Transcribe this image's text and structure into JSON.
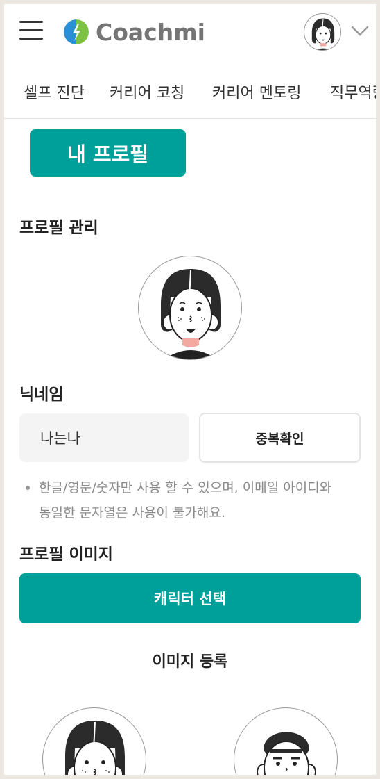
{
  "header": {
    "brand": "Coachmi",
    "colors": {
      "brand_blue": "#2a8fd6",
      "brand_green": "#7dc242",
      "accent": "#00a09a"
    }
  },
  "nav": {
    "items": [
      {
        "label": "셀프 진단"
      },
      {
        "label": "커리어 코칭"
      },
      {
        "label": "커리어 멘토링"
      },
      {
        "label": "직무역량"
      }
    ]
  },
  "page": {
    "title": "내 프로필",
    "section_profile": "프로필 관리",
    "nickname_label": "닉네임",
    "nickname_value": "나는나",
    "dup_check_label": "중복확인",
    "note_line1": "한글/영문/숫자만 사용 할 수 있으며, 이메일 아이디와",
    "note_line2": "동일한 문자열은 사용이 불가해요.",
    "image_label": "프로필 이미지",
    "character_button": "캐릭터 선택",
    "image_register": "이미지 등록"
  },
  "icons": {
    "menu": "hamburger-menu-icon",
    "logo": "coachmi-logo-icon",
    "account": "avatar",
    "dropdown": "chevron-down-icon"
  }
}
